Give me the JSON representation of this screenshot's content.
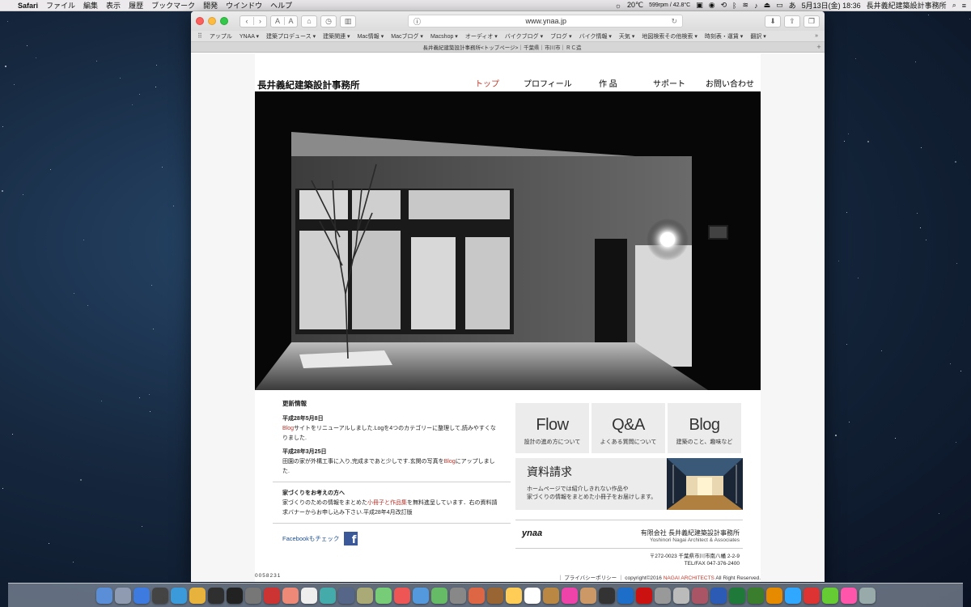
{
  "menubar": {
    "app": "Safari",
    "items": [
      "ファイル",
      "編集",
      "表示",
      "履歴",
      "ブックマーク",
      "開発",
      "ウインドウ",
      "ヘルプ"
    ],
    "temp": "20℃",
    "fan": "599rpm / 42.8°C",
    "datetime": "5月13日(金) 18:36",
    "active_title": "長井義紀建築設計事務所"
  },
  "browser": {
    "url": "www.ynaa.jp",
    "bookmarks": [
      "アップル",
      "YNAA ▾",
      "建築プロデュース ▾",
      "建築関連 ▾",
      "Mac情報 ▾",
      "Macブログ ▾",
      "Macshop ▾",
      "オーディオ ▾",
      "バイクブログ ▾",
      "ブログ ▾",
      "バイク情報 ▾",
      "天気 ▾",
      "地図検索その他検索 ▾",
      "時刻表・運賃 ▾",
      "翻訳 ▾"
    ],
    "tab_title": "長井義紀建築設計事務所<トップページ>｜千葉県｜市川市｜ＲＣ造"
  },
  "site": {
    "logo": "長井義紀建築設計事務所",
    "nav": [
      "トップ",
      "プロフィール",
      "作 品",
      "サポート",
      "お問い合わせ"
    ]
  },
  "news": {
    "heading": "更新情報",
    "entry1_date": "平成28年5月8日",
    "entry1_link": "Blog",
    "entry1_text": "サイトをリニューアルしました.Logを4つのカテゴリーに整理して,読みやすくなりました.",
    "entry2_date": "平成28年3月25日",
    "entry2_text_a": "田園の家が外構工事に入り,完成まであと少しです.玄関の写真を",
    "entry2_link": "Blog",
    "entry2_text_b": "にアップしました.",
    "house_heading": "家づくりをお考えの方へ",
    "house_text_a": "家づくりのための情報をまとめた",
    "house_link": "小冊子と作品集",
    "house_text_b": "を無料進呈しています．右の資料請求バナーからお申し込み下さい.平成28年4月改訂版",
    "facebook": "Facebookもチェック"
  },
  "tiles": [
    {
      "big": "Flow",
      "sub": "設計の進め方について"
    },
    {
      "big": "Q&A",
      "sub": "よくある質問について"
    },
    {
      "big": "Blog",
      "sub": "建築のこと、趣味など"
    }
  ],
  "request": {
    "title": "資料請求",
    "line1": "ホームページでは紹介しきれない作品や",
    "line2": "家づくりの情報をまとめた小冊子をお届けします。"
  },
  "company": {
    "mark": "ynaa",
    "name": "有限会社 長井義紀建築設計事務所",
    "name_en": "Yoshinori Nagai Architect & Associates",
    "address": "〒272-0023 千葉県市川市南八幡 2-2-9",
    "tel": "TEL/FAX 047-376-2400"
  },
  "footer": {
    "counter": "0058231",
    "privacy": "｜ プライバシーポリシー ｜",
    "copyright_a": "copyright©2016",
    "copyright_name": "NAGAI ARCHITECTS",
    "copyright_b": "All Right Reserved."
  },
  "dock": {
    "icons": [
      "finder",
      "launchpad",
      "safari",
      "dashboard",
      "wifi",
      "chrome",
      "activity",
      "terminal",
      "system-prefs",
      "x11",
      "app",
      "textedit",
      "preview",
      "home",
      "files",
      "grapher",
      "photos",
      "mail",
      "maps",
      "clock",
      "photos2",
      "tools",
      "notes",
      "calendar",
      "books",
      "itunes",
      "contacts",
      "reader",
      "photoshop",
      "acrobat",
      "mac",
      "app2",
      "app3",
      "word",
      "excel",
      "dreamweaver",
      "illustrator",
      "ps",
      "vivaldi",
      "check",
      "music",
      "trash"
    ]
  }
}
